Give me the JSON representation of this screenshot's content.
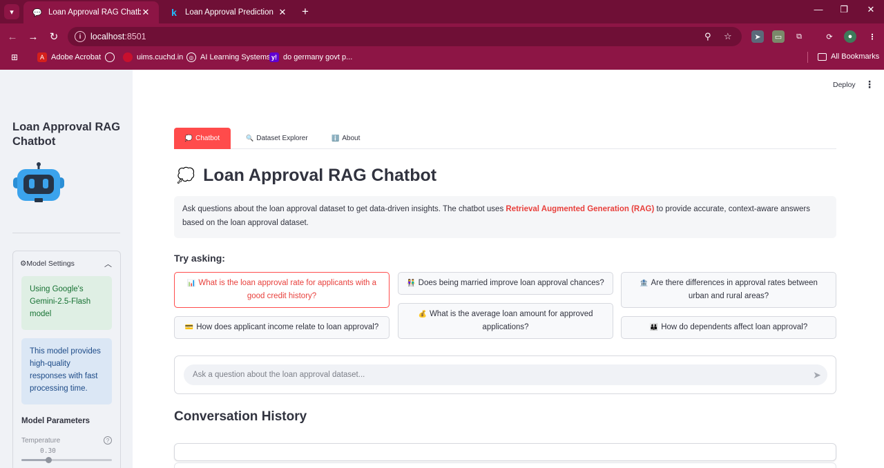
{
  "browser": {
    "tabs": [
      {
        "title": "Loan Approval RAG Chatbot",
        "favicon": "chat-bubble-icon"
      },
      {
        "title": "Loan Approval Prediction",
        "favicon": "k-letter-icon"
      }
    ],
    "url_host": "localhost",
    "url_port": ":8501",
    "bookmarks": [
      {
        "label": "Adobe Acrobat",
        "icon": "acrobat-icon"
      },
      {
        "label": "",
        "icon": "globe-icon"
      },
      {
        "label": "uims.cuchd.in",
        "icon": "uims-icon"
      },
      {
        "label": "AI Learning Systems",
        "icon": "ai-icon"
      },
      {
        "label": "do germany govt p...",
        "icon": "yahoo-icon"
      },
      {
        "label": "All Bookmarks",
        "icon": "folder-icon"
      }
    ],
    "colors": {
      "frame": "#6f0f36",
      "toolbar": "#8d1545"
    }
  },
  "sidebar": {
    "title": "Loan Approval RAG Chatbot",
    "expander_label": "⚙Model Settings",
    "model_info": "Using Google's Gemini-2.5-Flash model",
    "model_desc": "This model provides high-quality responses with fast processing time.",
    "params_heading": "Model Parameters",
    "temperature_label": "Temperature",
    "temperature_value": "0.30",
    "temperature_fraction": 0.3
  },
  "main": {
    "deploy_label": "Deploy",
    "tabs": [
      {
        "icon": "💭",
        "label": "Chatbot"
      },
      {
        "icon": "🔍",
        "label": "Dataset Explorer"
      },
      {
        "icon": "ℹ️",
        "label": "About"
      }
    ],
    "heading_icon": "💭",
    "heading": "Loan Approval RAG Chatbot",
    "intro_part1": "Ask questions about the loan approval dataset to get data-driven insights. The chatbot uses ",
    "intro_highlight": "Retrieval Augmented Generation (RAG)",
    "intro_part2": " to provide accurate, context-aware answers based on the loan approval dataset.",
    "try_heading": "Try asking:",
    "questions": [
      {
        "icon": "📊",
        "text": "What is the loan approval rate for applicants with a good credit history?"
      },
      {
        "icon": "👫",
        "text": "Does being married improve loan approval chances?"
      },
      {
        "icon": "🏦",
        "text": "Are there differences in approval rates between urban and rural areas?"
      },
      {
        "icon": "💳",
        "text": "How does applicant income relate to loan approval?"
      },
      {
        "icon": "💰",
        "text": "What is the average loan amount for approved applications?"
      },
      {
        "icon": "👪",
        "text": "How do dependents affect loan approval?"
      }
    ],
    "chat_placeholder": "Ask a question about the loan approval dataset...",
    "history_heading": "Conversation History",
    "accent": "#ff4b4b"
  }
}
